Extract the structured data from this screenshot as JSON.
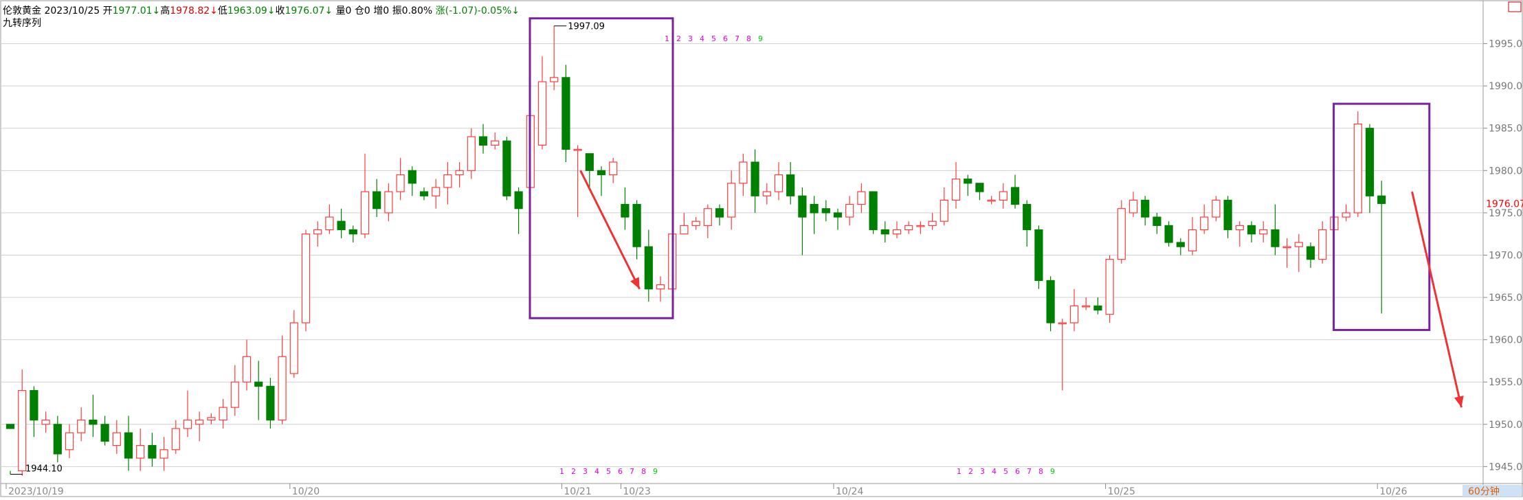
{
  "header": {
    "instrument": "伦敦黄金",
    "date": "2023/10/25",
    "open_label": "开",
    "open_value": "1977.01↓",
    "high_label": "高",
    "high_value": "1978.82↓",
    "low_label": "低",
    "low_value": "1963.09↓",
    "close_label": "收",
    "close_value": "1976.07↓",
    "volume": "量0",
    "position": "仓0",
    "increase": "增0",
    "amplitude": "振0.80%",
    "change": "涨(-1.07)-0.05%↓",
    "indicator_name": "九转序列"
  },
  "footer": {
    "timeframe": "60分钟"
  },
  "colors": {
    "up": "#ff3b3b",
    "down": "#008000",
    "grid": "#cfcfcf",
    "axis": "#888888",
    "box": "#7b1fa2",
    "arrow": "#ee3333",
    "seq_magenta": "#e000e0",
    "seq_green": "#00cc00",
    "last_price": "#ff0000"
  },
  "chart_data": {
    "type": "candlestick",
    "title": "伦敦黄金",
    "ylim": [
      1943,
      2000
    ],
    "y_ticks": [
      "1945.00",
      "1950.00",
      "1955.00",
      "1960.00",
      "1965.00",
      "1970.00",
      "1975.00",
      "1980.00",
      "1985.00",
      "1990.00",
      "1995.00"
    ],
    "x_labels": [
      {
        "label": "2023/10/19",
        "index": 0
      },
      {
        "label": "10/20",
        "index": 24
      },
      {
        "label": "10/21",
        "index": 47
      },
      {
        "label": "10/23",
        "index": 52
      },
      {
        "label": "10/24",
        "index": 70
      },
      {
        "label": "10/25",
        "index": 93
      },
      {
        "label": "10/26",
        "index": 116
      }
    ],
    "candles": [
      [
        1950.0,
        1949.5,
        1944.1,
        1944.5
      ],
      [
        1944.5,
        1954.0,
        1956.5,
        1943.9
      ],
      [
        1954.0,
        1950.5,
        1954.5,
        1948.5
      ],
      [
        1950.0,
        1950.5,
        1951.5,
        1949.0
      ],
      [
        1950.0,
        1946.5,
        1951.0,
        1945.5
      ],
      [
        1947.0,
        1949.0,
        1950.0,
        1946.0
      ],
      [
        1949.0,
        1950.5,
        1952.0,
        1948.0
      ],
      [
        1950.5,
        1950.0,
        1953.5,
        1948.5
      ],
      [
        1950.0,
        1948.0,
        1951.0,
        1947.5
      ],
      [
        1947.5,
        1949.0,
        1950.5,
        1946.5
      ],
      [
        1949.0,
        1946.0,
        1951.0,
        1944.5
      ],
      [
        1946.0,
        1947.5,
        1949.5,
        1944.5
      ],
      [
        1947.5,
        1946.0,
        1949.0,
        1945.0
      ],
      [
        1946.0,
        1947.0,
        1948.5,
        1944.5
      ],
      [
        1947.0,
        1949.5,
        1950.5,
        1946.5
      ],
      [
        1949.5,
        1950.5,
        1954.0,
        1948.5
      ],
      [
        1950.0,
        1950.5,
        1951.5,
        1948.0
      ],
      [
        1950.5,
        1950.8,
        1951.3,
        1950.0
      ],
      [
        1950.5,
        1952.0,
        1953.0,
        1949.5
      ],
      [
        1952.0,
        1955.0,
        1957.0,
        1951.0
      ],
      [
        1955.0,
        1958.0,
        1960.0,
        1954.0
      ],
      [
        1955.0,
        1954.5,
        1957.5,
        1950.5
      ],
      [
        1954.5,
        1950.5,
        1955.5,
        1949.5
      ],
      [
        1950.5,
        1958.0,
        1960.5,
        1950.0
      ],
      [
        1956.0,
        1962.0,
        1963.5,
        1955.5
      ],
      [
        1962.0,
        1972.5,
        1973.0,
        1961.0
      ],
      [
        1972.5,
        1973.0,
        1974.0,
        1971.0
      ],
      [
        1973.0,
        1974.5,
        1976.0,
        1972.5
      ],
      [
        1974.0,
        1973.0,
        1975.5,
        1972.0
      ],
      [
        1973.0,
        1972.5,
        1973.5,
        1971.5
      ],
      [
        1972.5,
        1977.5,
        1982.0,
        1972.0
      ],
      [
        1977.5,
        1975.5,
        1979.0,
        1974.5
      ],
      [
        1975.0,
        1977.5,
        1978.5,
        1974.0
      ],
      [
        1977.5,
        1979.5,
        1981.5,
        1976.5
      ],
      [
        1980.0,
        1978.5,
        1980.5,
        1977.0
      ],
      [
        1977.5,
        1977.0,
        1978.0,
        1976.5
      ],
      [
        1977.0,
        1978.0,
        1979.0,
        1975.5
      ],
      [
        1978.0,
        1979.5,
        1981.0,
        1976.0
      ],
      [
        1979.5,
        1980.0,
        1981.0,
        1978.0
      ],
      [
        1980.0,
        1984.0,
        1985.0,
        1979.0
      ],
      [
        1984.0,
        1983.0,
        1985.5,
        1982.0
      ],
      [
        1983.0,
        1983.5,
        1984.5,
        1982.5
      ],
      [
        1983.5,
        1977.0,
        1984.0,
        1976.5
      ],
      [
        1977.5,
        1975.5,
        1978.0,
        1972.5
      ],
      [
        1978.0,
        1986.5,
        1987.5,
        1978.0
      ],
      [
        1983.0,
        1990.5,
        1993.5,
        1982.5
      ],
      [
        1990.5,
        1991.0,
        1997.1,
        1989.5
      ],
      [
        1991.0,
        1982.5,
        1992.5,
        1981.0
      ],
      [
        1982.5,
        1982.5,
        1983.0,
        1974.5
      ],
      [
        1982.0,
        1980.0,
        1981.5,
        1978.0
      ],
      [
        1980.0,
        1979.5,
        1980.5,
        1977.0
      ],
      [
        1979.5,
        1981.0,
        1981.5,
        1978.5
      ],
      [
        1976.0,
        1974.5,
        1978.0,
        1973.0
      ],
      [
        1976.0,
        1971.0,
        1976.5,
        1969.5
      ],
      [
        1971.0,
        1966.0,
        1973.0,
        1964.5
      ],
      [
        1966.0,
        1966.5,
        1967.5,
        1964.5
      ],
      [
        1966.0,
        1972.5,
        1974.0,
        1965.5
      ],
      [
        1972.5,
        1973.5,
        1975.0,
        1972.5
      ],
      [
        1973.5,
        1974.0,
        1974.5,
        1973.0
      ],
      [
        1973.5,
        1975.5,
        1976.0,
        1972.0
      ],
      [
        1975.5,
        1974.5,
        1976.0,
        1973.5
      ],
      [
        1974.5,
        1978.5,
        1980.0,
        1973.0
      ],
      [
        1978.5,
        1981.0,
        1982.0,
        1977.0
      ],
      [
        1981.0,
        1977.0,
        1982.5,
        1975.0
      ],
      [
        1977.0,
        1977.5,
        1978.5,
        1976.0
      ],
      [
        1977.5,
        1979.5,
        1981.0,
        1976.5
      ],
      [
        1979.5,
        1977.0,
        1981.0,
        1976.0
      ],
      [
        1977.0,
        1974.5,
        1978.0,
        1970.0
      ],
      [
        1976.0,
        1975.0,
        1977.0,
        1972.5
      ],
      [
        1975.5,
        1975.0,
        1976.5,
        1974.0
      ],
      [
        1975.0,
        1974.5,
        1975.5,
        1973.0
      ],
      [
        1974.5,
        1976.0,
        1977.0,
        1973.5
      ],
      [
        1976.0,
        1977.5,
        1978.5,
        1975.0
      ],
      [
        1977.5,
        1973.0,
        1977.5,
        1972.5
      ],
      [
        1973.0,
        1972.5,
        1974.0,
        1971.5
      ],
      [
        1972.5,
        1973.0,
        1974.0,
        1972.0
      ],
      [
        1973.0,
        1973.5,
        1974.0,
        1972.5
      ],
      [
        1973.5,
        1973.5,
        1974.0,
        1972.5
      ],
      [
        1973.5,
        1974.0,
        1975.0,
        1973.0
      ],
      [
        1974.0,
        1976.5,
        1978.0,
        1973.5
      ],
      [
        1976.5,
        1979.0,
        1981.0,
        1975.5
      ],
      [
        1979.0,
        1978.5,
        1979.5,
        1977.0
      ],
      [
        1978.5,
        1977.5,
        1978.5,
        1976.5
      ],
      [
        1976.5,
        1976.5,
        1977.0,
        1976.0
      ],
      [
        1976.5,
        1977.5,
        1978.5,
        1975.5
      ],
      [
        1978.0,
        1976.0,
        1979.5,
        1975.5
      ],
      [
        1976.0,
        1973.0,
        1976.5,
        1971.0
      ],
      [
        1973.0,
        1967.0,
        1973.5,
        1966.0
      ],
      [
        1967.0,
        1962.0,
        1967.5,
        1961.0
      ],
      [
        1962.0,
        1962.0,
        1962.5,
        1954.0
      ],
      [
        1962.0,
        1964.0,
        1966.0,
        1961.0
      ],
      [
        1964.0,
        1964.0,
        1965.0,
        1963.5
      ],
      [
        1964.0,
        1963.5,
        1965.0,
        1963.0
      ],
      [
        1963.0,
        1969.5,
        1970.0,
        1962.0
      ],
      [
        1969.5,
        1975.5,
        1976.5,
        1969.0
      ],
      [
        1975.0,
        1976.5,
        1977.5,
        1974.5
      ],
      [
        1976.5,
        1974.5,
        1977.0,
        1973.5
      ],
      [
        1974.5,
        1973.5,
        1975.0,
        1972.5
      ],
      [
        1973.5,
        1971.5,
        1974.0,
        1971.0
      ],
      [
        1971.5,
        1971.0,
        1972.0,
        1970.0
      ],
      [
        1970.5,
        1973.0,
        1974.5,
        1970.0
      ],
      [
        1973.0,
        1974.5,
        1976.0,
        1972.5
      ],
      [
        1974.5,
        1976.5,
        1977.0,
        1974.0
      ],
      [
        1976.5,
        1973.0,
        1977.0,
        1972.0
      ],
      [
        1973.0,
        1973.5,
        1974.0,
        1971.0
      ],
      [
        1973.5,
        1972.5,
        1974.0,
        1971.5
      ],
      [
        1972.5,
        1973.0,
        1974.0,
        1971.5
      ],
      [
        1973.0,
        1971.0,
        1976.0,
        1970.0
      ],
      [
        1971.0,
        1971.0,
        1972.0,
        1968.5
      ],
      [
        1971.0,
        1971.5,
        1972.5,
        1968.0
      ],
      [
        1971.0,
        1969.5,
        1971.5,
        1968.5
      ],
      [
        1969.5,
        1973.0,
        1974.0,
        1969.0
      ],
      [
        1973.0,
        1974.5,
        1975.5,
        1972.5
      ],
      [
        1974.5,
        1975.0,
        1976.0,
        1974.0
      ],
      [
        1975.0,
        1985.5,
        1987.0,
        1974.5
      ],
      [
        1985.0,
        1977.0,
        1985.5,
        1975.0
      ],
      [
        1977.0,
        1976.1,
        1978.8,
        1963.1
      ]
    ],
    "annotations": {
      "max_label": "1997.09",
      "min_label": "1944.10",
      "last_price_label": "1976.07",
      "nine_seq_upper": [
        "1",
        "2",
        "3",
        "4",
        "5",
        "6",
        "7",
        "8",
        "9"
      ],
      "nine_seq_lower_a": [
        "1",
        "2",
        "3",
        "4",
        "5",
        "6",
        "7",
        "8",
        "9"
      ],
      "nine_seq_lower_b": [
        "1",
        "2",
        "3",
        "4",
        "5",
        "6",
        "7",
        "8",
        "9"
      ],
      "boxes": [
        {
          "from": 45,
          "to": 55
        },
        {
          "from": 113,
          "to": 119
        }
      ]
    },
    "legend": "none",
    "grid": true
  }
}
